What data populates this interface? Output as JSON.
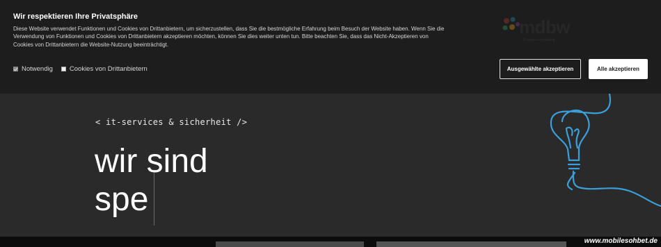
{
  "cookie_banner": {
    "title": "Wir respektieren Ihre Privatsphäre",
    "text": "Diese Website verwendet Funktionen und Cookies von Drittanbietern, um sicherzustellen, dass Sie die bestmögliche Erfahrung beim Besuch der Website haben. Wenn Sie die Verwendung von Funktionen und Cookies von Drittanbietern akzeptieren möchten, können Sie dies weiter unten tun. Bitte beachten Sie, dass das Nicht-Akzeptieren von Cookies von Drittanbietern die Website-Nutzung beeinträchtigt.",
    "options": [
      {
        "label": "Notwendig",
        "checked": true
      },
      {
        "label": "Cookies von Drittanbietern",
        "checked": false
      }
    ],
    "accept_selected_label": "Ausgewählte akzeptieren",
    "accept_all_label": "Alle akzeptieren"
  },
  "logo": {
    "word": "mdbw",
    "subtitle": "IT-service consulting"
  },
  "hero": {
    "tagline": "< it-services & sicherheit />",
    "headline_line1": "wir sind",
    "headline_line2": "spe"
  },
  "watermark": "www.mobilesohbet.de",
  "colors": {
    "banner_bg": "#1d1d1d",
    "hero_bg": "#2a2a2a",
    "bulb_stroke": "#3aa0dc",
    "button_primary_bg": "#ffffff"
  }
}
